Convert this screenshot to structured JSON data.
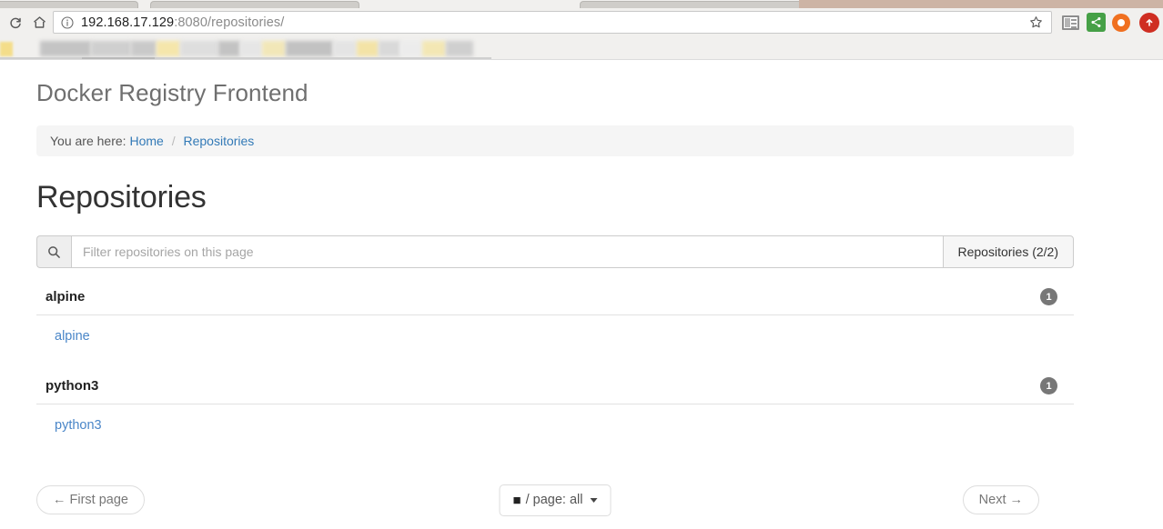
{
  "browser": {
    "url_host": "192.168.17.129",
    "url_rest": ":8080/repositories/",
    "reload_icon": "reload-icon",
    "home_icon": "home-icon",
    "info_icon": "site-info-icon",
    "star_icon": "bookmark-star-icon",
    "extensions": [
      {
        "name": "news-reader-extension-icon",
        "color": "#8d8d8d"
      },
      {
        "name": "share-extension-icon",
        "color": "#46a046"
      },
      {
        "name": "orange-circle-extension-icon",
        "color": "#f07020"
      },
      {
        "name": "red-circle-extension-icon",
        "color": "#cf2e22"
      }
    ]
  },
  "page": {
    "site_title": "Docker Registry Frontend",
    "heading": "Repositories"
  },
  "breadcrumb": {
    "prefix": "You are here:",
    "home_label": "Home",
    "separator": "/",
    "current_label": "Repositories"
  },
  "filter": {
    "icon": "search-icon",
    "placeholder": "Filter repositories on this page",
    "value": "",
    "count_label": "Repositories (2/2)"
  },
  "repositories": [
    {
      "name": "alpine",
      "badge": "1",
      "items": [
        {
          "label": "alpine"
        }
      ]
    },
    {
      "name": "python3",
      "badge": "1",
      "items": [
        {
          "label": "python3"
        }
      ]
    }
  ],
  "pager": {
    "first_label": "← First page",
    "next_label": "Next →",
    "per_page_icon": "book-icon",
    "per_page_glyph": "■",
    "per_page_label": "/ page: all"
  },
  "colors": {
    "link": "#337ab7",
    "repo_link": "#4a86c8",
    "badge_bg": "#777777",
    "breadcrumb_bg": "#f5f5f5",
    "title_gray": "#6f6f6f"
  }
}
